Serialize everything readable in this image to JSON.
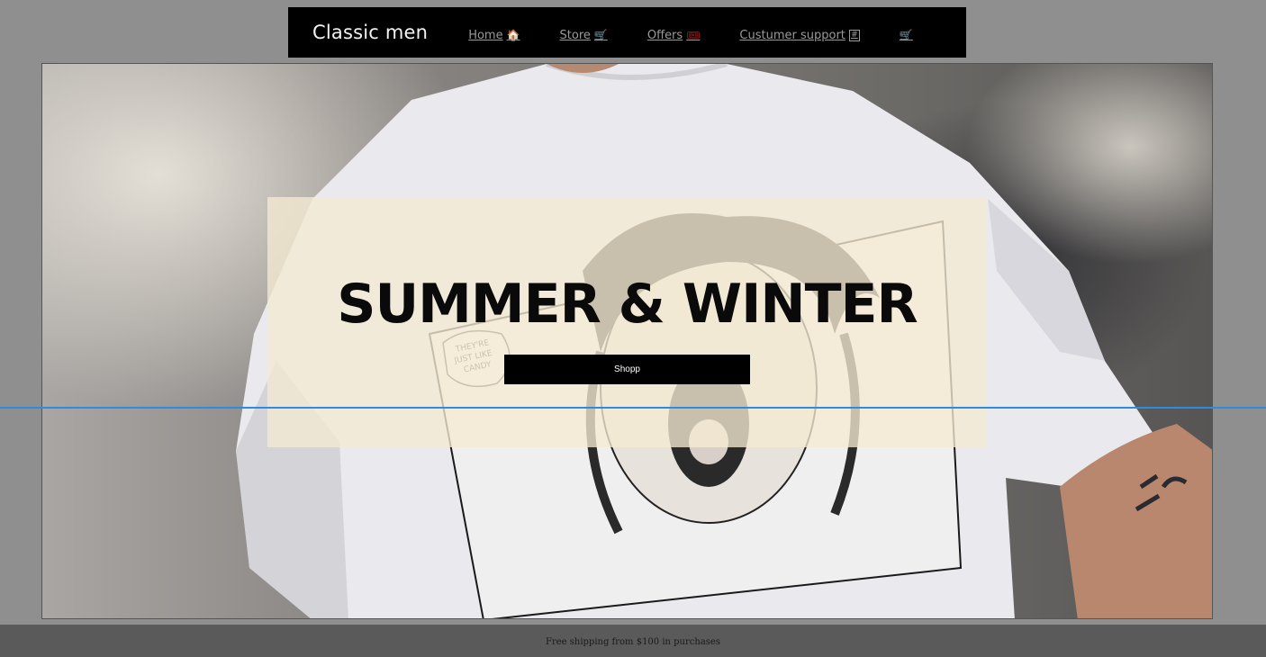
{
  "navbar": {
    "brand": "Classic men",
    "links": [
      {
        "label": "Home",
        "icon": "house-icon",
        "glyph": "🏠"
      },
      {
        "label": "Store",
        "icon": "cart-icon",
        "glyph": "🛒"
      },
      {
        "label": "Offers",
        "icon": "ticket-icon",
        "glyph": "🎟"
      },
      {
        "label": "Custumer support",
        "icon": "hash-icon",
        "glyph": "#"
      }
    ],
    "cart": {
      "icon": "cart-icon",
      "glyph": "🛒"
    }
  },
  "hero": {
    "headline": "SUMMER & WINTER",
    "button_label": "Shopp",
    "shirt_print_text": "THEY'RE JUST LIKE CANDY"
  },
  "footer": {
    "text": "Free shipping from $100 in purchases"
  },
  "colors": {
    "page_bg": "#8f8f8f",
    "navbar_bg": "#000000",
    "overlay_bg": "#f5ead2",
    "guide_line": "#2b8ce0",
    "footer_bg": "#5a5a5a"
  }
}
